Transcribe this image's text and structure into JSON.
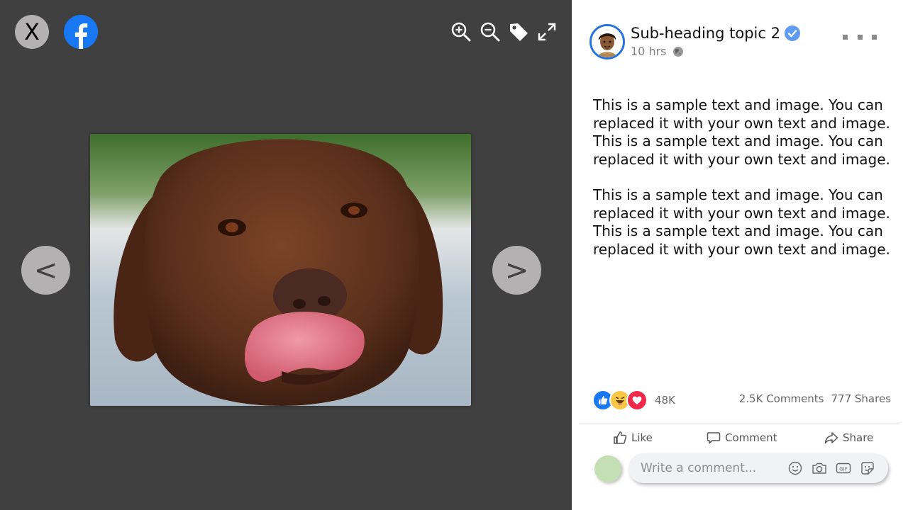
{
  "viewer": {
    "close_label": "X",
    "prev_label": "<",
    "next_label": ">",
    "icons": [
      "zoom-in-icon",
      "zoom-out-icon",
      "tag-icon",
      "fullscreen-icon"
    ],
    "photo_description_icon": "chocolate-labrador-photo"
  },
  "post": {
    "author": "Sub-heading topic 2",
    "time": "10 hrs",
    "paragraphs": [
      "This is a sample text and image. You can replaced it with your own text and image. This is a sample text and image. You can replaced it with your own text and image.",
      "This is a sample text and image. You can replaced it with your own text and image. This is a sample text and image. You can replaced it with your own text and image."
    ],
    "reaction_count": "48K",
    "comments": "2.5K Comments",
    "shares": "777 Shares"
  },
  "actions": {
    "like": "Like",
    "comment": "Comment",
    "share": "Share"
  },
  "comment_box": {
    "placeholder": "Write a comment..."
  },
  "colors": {
    "viewer_bg": "#404040",
    "facebook_blue": "#1877f2",
    "nav_button": "#b3b1b1"
  }
}
